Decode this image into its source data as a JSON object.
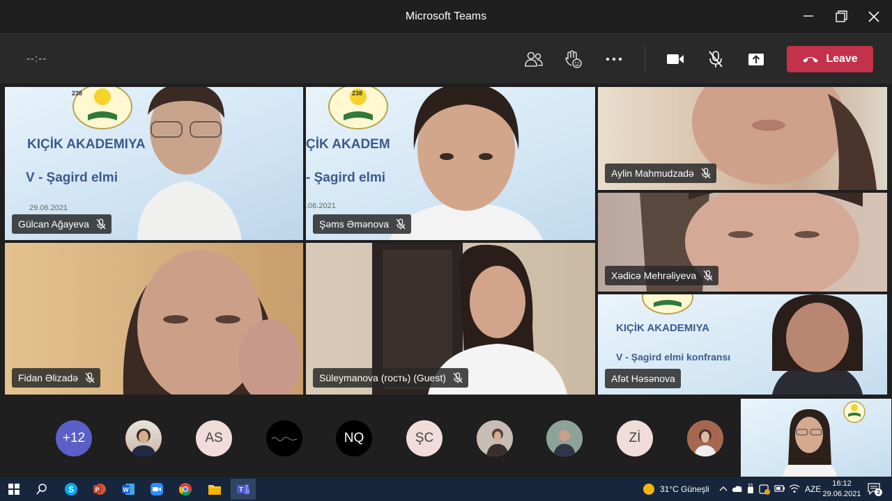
{
  "window": {
    "title": "Microsoft Teams"
  },
  "meeting": {
    "timer": "--:--",
    "leave_label": "Leave"
  },
  "participants": [
    {
      "name": "Gülcan Ağayeva",
      "muted": true
    },
    {
      "name": "Şəms Əmənova",
      "muted": true
    },
    {
      "name": "Aylin Mahmudzadə",
      "muted": true
    },
    {
      "name": "Xədicə Mehrəliyeva",
      "muted": true
    },
    {
      "name": "Fidan Əlizadə",
      "muted": true
    },
    {
      "name": "Süleymanova (гость) (Guest)",
      "muted": true
    },
    {
      "name": "Afət Həsənova",
      "muted": false
    }
  ],
  "slide": {
    "badge": "238",
    "academy": "KIÇİK AKADEMIYA",
    "academy_short": "ÇİK AKADEM",
    "conference": "V - Şagird elmi",
    "conference_short": "- Şagird elmi",
    "conference_full": "V - Şagird elmi konfransı",
    "date": "29.06.2021",
    "date_short": ".06.2021"
  },
  "roster": {
    "overflow": "+12",
    "initials": [
      "AS",
      "NQ",
      "ŞC",
      "Zİ"
    ]
  },
  "taskbar": {
    "weather": "31°C  Güneşli",
    "language": "AZE",
    "time": "16:12",
    "date": "29.06.2021",
    "notifications": "3"
  },
  "colors": {
    "leave": "#c4314b",
    "overflow_avatar": "#5b5fc7",
    "initials_avatar": "#f1dcdc",
    "taskbar": "#17263c"
  }
}
